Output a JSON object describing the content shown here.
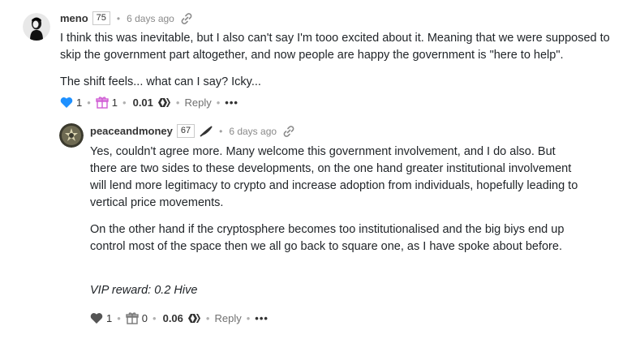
{
  "comments": [
    {
      "author": "meno",
      "reputation": "75",
      "age": "6 days ago",
      "paragraphs": [
        "I think this was inevitable, but I also can't say I'm tooo excited about it. Meaning that we were supposed to skip the government part altogether, and now people are happy the government is \"here to help\".",
        "The shift feels... what can I say? Icky..."
      ],
      "votes": "1",
      "gifts": "1",
      "payout": "0.01",
      "reply_label": "Reply",
      "more_label": "•••",
      "heart_color": "#1e90ff",
      "gift_color": "#d05cd4"
    },
    {
      "author": "peaceandmoney",
      "reputation": "67",
      "age": "6 days ago",
      "paragraphs": [
        "Yes, couldn't agree more. Many welcome this government involvement, and I do also. But there are two sides to these developments, on the one hand greater institutional involvement will lend more legitimacy to crypto and increase adoption from individuals, hopefully leading to vertical price movements.",
        "On the other hand if the cryptosphere becomes too institutionalised and the big biys end up control most of the space then we all go back to square one, as I have spoke about before."
      ],
      "vip_reward": "VIP reward: 0.2 Hive",
      "votes": "1",
      "gifts": "0",
      "payout": "0.06",
      "reply_label": "Reply",
      "more_label": "•••",
      "heart_color": "#555555",
      "gift_color": "#777777"
    }
  ]
}
